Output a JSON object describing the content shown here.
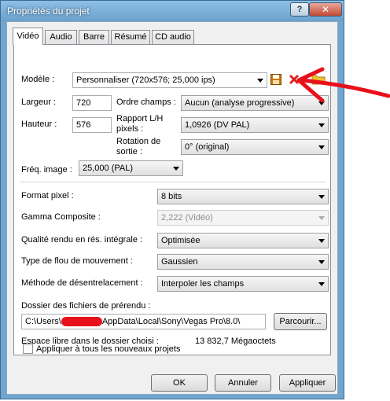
{
  "window": {
    "title": "Propriétés du projet",
    "help": "?",
    "close": "✕"
  },
  "tabs": [
    "Vidéo",
    "Audio",
    "Barre",
    "Résumé",
    "CD audio"
  ],
  "video": {
    "model": {
      "label": "Modèle :",
      "value": "Personnaliser (720x576; 25,000 ips)"
    },
    "width": {
      "label": "Largeur :",
      "value": "720"
    },
    "height": {
      "label": "Hauteur :",
      "value": "576"
    },
    "field_order": {
      "label": "Ordre champs :",
      "value": "Aucun (analyse progressive)"
    },
    "pixel_ratio": {
      "label_line1": "Rapport L/H",
      "label_line2": "pixels :",
      "value": "1,0926 (DV PAL)"
    },
    "rotation": {
      "label_line1": "Rotation de",
      "label_line2": "sortie :",
      "value": "0° (original)"
    },
    "frame_rate": {
      "label": "Fréq. image :",
      "value": "25,000 (PAL)"
    },
    "pixel_format": {
      "label": "Format pixel :",
      "value": "8 bits"
    },
    "gamma": {
      "label": "Gamma Composite :",
      "value": "2,222 (Vidéo)"
    },
    "render_quality": {
      "label": "Qualité rendu en rés. intégrale :",
      "value": "Optimisée"
    },
    "motion_blur": {
      "label": "Type de flou de mouvement :",
      "value": "Gaussien"
    },
    "deinterlace": {
      "label": "Méthode de désentrelacement :",
      "value": "Interpoler les champs"
    },
    "prerender_folder": {
      "label": "Dossier des fichiers de prérendu :",
      "path_start": "C:\\Users\\",
      "path_end": "AppData\\Local\\Sony\\Vegas Pro\\8.0\\",
      "browse": "Parcourir..."
    },
    "free_space": {
      "label": "Espace libre dans le dossier choisi :",
      "value": "13 832,7 Mégaoctets"
    },
    "apply_all": {
      "label": "Appliquer à tous les nouveaux projets",
      "checked": false
    }
  },
  "buttons": {
    "ok": "OK",
    "cancel": "Annuler",
    "apply": "Appliquer"
  },
  "colors": {
    "annotation": "#e8101a",
    "save_icon": "#d07a00",
    "delete_icon": "#e02020",
    "folder_icon": "#f0c030"
  }
}
